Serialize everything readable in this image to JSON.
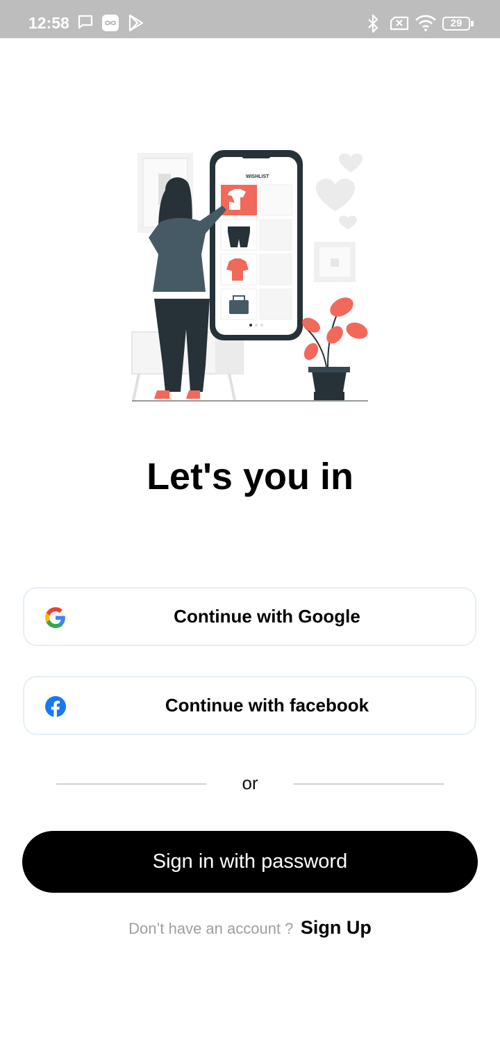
{
  "status_bar": {
    "time": "12:58",
    "battery_level": "29",
    "icons": [
      "message-icon",
      "infinity-app-icon",
      "play-store-icon",
      "bluetooth-icon",
      "no-sim-icon",
      "wifi-icon",
      "battery-icon"
    ]
  },
  "illustration": {
    "name": "wishlist-shopping-illustration",
    "screen_header": "WISHLIST"
  },
  "main": {
    "title": "Let's you in"
  },
  "buttons": {
    "google_label": "Continue with Google",
    "facebook_label": "Continue with facebook",
    "password_label": "Sign in with password"
  },
  "divider": {
    "or_label": "or"
  },
  "signup": {
    "prompt": "Don’t have an account ?",
    "link": "Sign Up"
  },
  "colors": {
    "accent_coral": "#f0695a",
    "dark_slate": "#263238",
    "facebook_blue": "#1877f2",
    "button_black": "#000000"
  }
}
